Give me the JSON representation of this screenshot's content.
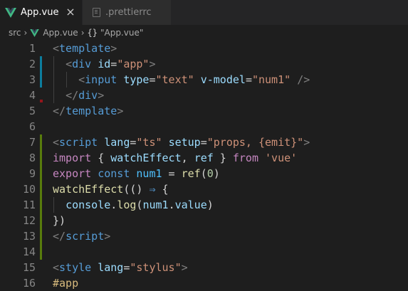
{
  "colors": {
    "vue_icon": "#41b883",
    "modified_gutter": "#0c7d9d",
    "added_gutter": "#587c0c",
    "deleted_marker": "#94151b"
  },
  "tabs": [
    {
      "label": "App.vue",
      "icon": "vue-logo-icon",
      "active": true,
      "close": "×"
    },
    {
      "label": ".prettierrc",
      "icon": "file-icon",
      "active": false
    }
  ],
  "breadcrumb": {
    "folder": "src",
    "file": "App.vue",
    "symbol_icon": "{}",
    "symbol": "\"App.vue\""
  },
  "editor": {
    "lines": [
      {
        "n": "1",
        "tokens": [
          [
            "t-punc",
            "<"
          ],
          [
            "t-tag",
            "template"
          ],
          [
            "t-punc",
            ">"
          ]
        ]
      },
      {
        "n": "2",
        "tokens": [
          [
            "t-plain",
            "  "
          ],
          [
            "t-punc",
            "<"
          ],
          [
            "t-tag",
            "div"
          ],
          [
            "t-plain",
            " "
          ],
          [
            "t-attr",
            "id"
          ],
          [
            "t-plain",
            "="
          ],
          [
            "t-str",
            "\"app\""
          ],
          [
            "t-punc",
            ">"
          ]
        ]
      },
      {
        "n": "3",
        "tokens": [
          [
            "t-plain",
            "    "
          ],
          [
            "t-punc",
            "<"
          ],
          [
            "t-tag",
            "input"
          ],
          [
            "t-plain",
            " "
          ],
          [
            "t-attr",
            "type"
          ],
          [
            "t-plain",
            "="
          ],
          [
            "t-str",
            "\"text\""
          ],
          [
            "t-plain",
            " "
          ],
          [
            "t-attr",
            "v-model"
          ],
          [
            "t-plain",
            "="
          ],
          [
            "t-str",
            "\"num1\""
          ],
          [
            "t-plain",
            " "
          ],
          [
            "t-punc",
            "/>"
          ]
        ]
      },
      {
        "n": "4",
        "tokens": [
          [
            "t-plain",
            "  "
          ],
          [
            "t-punc",
            "</"
          ],
          [
            "t-tag",
            "div"
          ],
          [
            "t-punc",
            ">"
          ]
        ]
      },
      {
        "n": "5",
        "tokens": [
          [
            "t-punc",
            "</"
          ],
          [
            "t-tag",
            "template"
          ],
          [
            "t-punc",
            ">"
          ]
        ]
      },
      {
        "n": "6",
        "tokens": []
      },
      {
        "n": "7",
        "tokens": [
          [
            "t-punc",
            "<"
          ],
          [
            "t-tag",
            "script"
          ],
          [
            "t-plain",
            " "
          ],
          [
            "t-attr",
            "lang"
          ],
          [
            "t-plain",
            "="
          ],
          [
            "t-str",
            "\"ts\""
          ],
          [
            "t-plain",
            " "
          ],
          [
            "t-attr",
            "setup"
          ],
          [
            "t-plain",
            "="
          ],
          [
            "t-str",
            "\"props, {emit}\""
          ],
          [
            "t-punc",
            ">"
          ]
        ]
      },
      {
        "n": "8",
        "tokens": [
          [
            "t-kw",
            "import"
          ],
          [
            "t-plain",
            " { "
          ],
          [
            "t-var",
            "watchEffect"
          ],
          [
            "t-plain",
            ", "
          ],
          [
            "t-var",
            "ref"
          ],
          [
            "t-plain",
            " } "
          ],
          [
            "t-kw",
            "from"
          ],
          [
            "t-plain",
            " "
          ],
          [
            "t-str",
            "'vue'"
          ]
        ]
      },
      {
        "n": "9",
        "tokens": [
          [
            "t-kw",
            "export"
          ],
          [
            "t-plain",
            " "
          ],
          [
            "t-bl",
            "const"
          ],
          [
            "t-plain",
            " "
          ],
          [
            "t-const",
            "num1"
          ],
          [
            "t-plain",
            " = "
          ],
          [
            "t-fn",
            "ref"
          ],
          [
            "t-plain",
            "("
          ],
          [
            "t-num",
            "0"
          ],
          [
            "t-plain",
            ")"
          ]
        ]
      },
      {
        "n": "10",
        "tokens": [
          [
            "t-fn",
            "watchEffect"
          ],
          [
            "t-plain",
            "(() "
          ],
          [
            "t-bl",
            "⇒"
          ],
          [
            "t-plain",
            " {"
          ]
        ]
      },
      {
        "n": "11",
        "tokens": [
          [
            "t-plain",
            "  "
          ],
          [
            "t-var",
            "console"
          ],
          [
            "t-plain",
            "."
          ],
          [
            "t-fn",
            "log"
          ],
          [
            "t-plain",
            "("
          ],
          [
            "t-var",
            "num1"
          ],
          [
            "t-plain",
            "."
          ],
          [
            "t-var",
            "value"
          ],
          [
            "t-plain",
            ")"
          ]
        ]
      },
      {
        "n": "12",
        "tokens": [
          [
            "t-plain",
            "})"
          ]
        ]
      },
      {
        "n": "13",
        "tokens": [
          [
            "t-punc",
            "</"
          ],
          [
            "t-tag",
            "script"
          ],
          [
            "t-punc",
            ">"
          ]
        ]
      },
      {
        "n": "14",
        "tokens": []
      },
      {
        "n": "15",
        "tokens": [
          [
            "t-punc",
            "<"
          ],
          [
            "t-tag",
            "style"
          ],
          [
            "t-plain",
            " "
          ],
          [
            "t-attr",
            "lang"
          ],
          [
            "t-plain",
            "="
          ],
          [
            "t-str",
            "\"stylus\""
          ],
          [
            "t-punc",
            ">"
          ]
        ]
      },
      {
        "n": "16",
        "tokens": [
          [
            "t-sel",
            "#app"
          ]
        ]
      }
    ]
  }
}
